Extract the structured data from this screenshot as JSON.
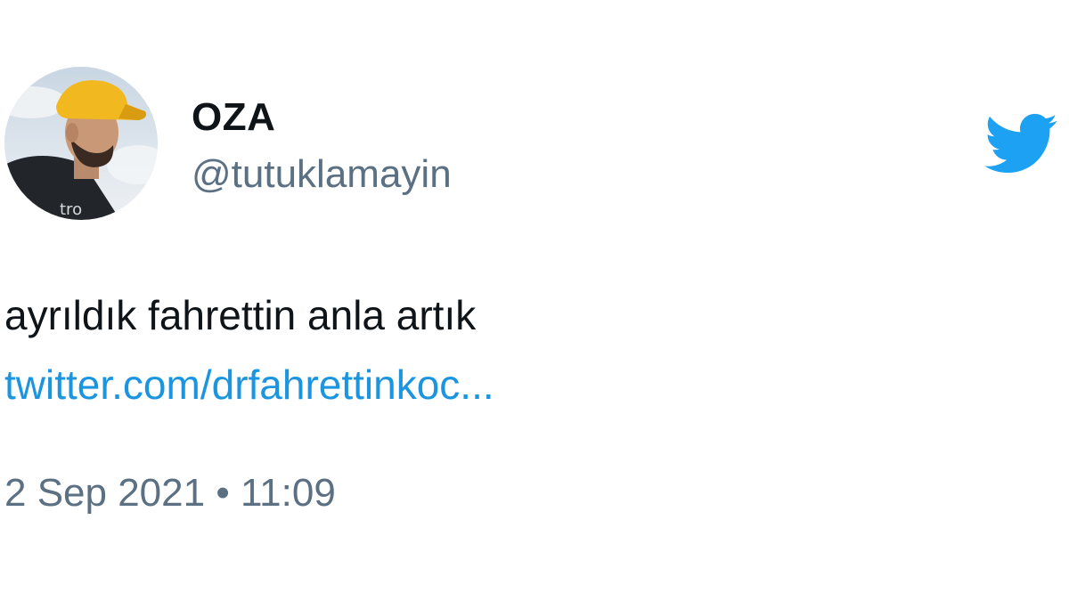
{
  "author": {
    "display_name": "OZA",
    "handle": "@tutuklamayin"
  },
  "brand_icon": "twitter-bird-icon",
  "tweet": {
    "text": "ayrıldık fahrettin anla artık",
    "link_text": "twitter.com/drfahrettinkoc...",
    "timestamp": "2 Sep 2021 • 11:09"
  },
  "colors": {
    "text": "#0f1419",
    "secondary": "#5b7083",
    "link": "#1b95e0",
    "twitter_blue": "#1da1f2",
    "background": "#ffffff"
  }
}
